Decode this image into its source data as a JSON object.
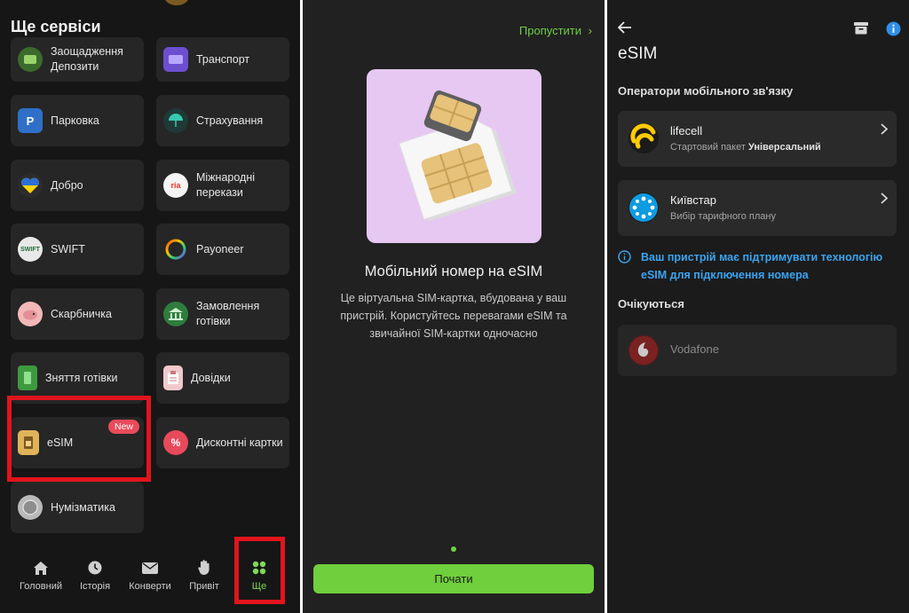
{
  "panel1": {
    "title": "Ще сервіси",
    "tiles": [
      {
        "label": "Заощадження\nДепозити",
        "icon": "piggy-bank-deposit-icon"
      },
      {
        "label": "Транспорт",
        "icon": "transport-ticket-icon"
      },
      {
        "label": "Парковка",
        "icon": "parking-icon"
      },
      {
        "label": "Страхування",
        "icon": "umbrella-icon"
      },
      {
        "label": "Добро",
        "icon": "ukraine-heart-icon"
      },
      {
        "label": "Міжнародні\nперекази",
        "icon": "ria-money-transfer-icon"
      },
      {
        "label": "SWIFT",
        "icon": "swift-icon"
      },
      {
        "label": "Payoneer",
        "icon": "payoneer-icon"
      },
      {
        "label": "Скарбничка",
        "icon": "piggy-icon"
      },
      {
        "label": "Замовлення\nготівки",
        "icon": "bank-building-icon"
      },
      {
        "label": "Зняття готівки",
        "icon": "atm-icon"
      },
      {
        "label": "Довідки",
        "icon": "clipboard-icon"
      },
      {
        "label": "eSIM",
        "icon": "sim-card-icon",
        "badge": "New"
      },
      {
        "label": "Дисконтні картки",
        "icon": "discount-percent-icon"
      },
      {
        "label": "Нумізматика",
        "icon": "coin-icon"
      }
    ],
    "ria_text": "ria",
    "swift_icon_text": "SWIFT",
    "nav": [
      {
        "label": "Головний",
        "icon": "home-icon"
      },
      {
        "label": "Історія",
        "icon": "clock-icon"
      },
      {
        "label": "Конверти",
        "icon": "envelope-icon"
      },
      {
        "label": "Привіт",
        "icon": "hand-wave-icon"
      },
      {
        "label": "Ще",
        "icon": "grid-dots-icon",
        "active": true
      }
    ]
  },
  "panel2": {
    "skip_label": "Пропустити",
    "title": "Мобільний номер на eSIM",
    "description": "Це віртуальна SIM-картка, вбудована у ваш пристрій. Користуйтесь перевагами eSIM та звичайної SIM-картки одночасно",
    "start_label": "Почати"
  },
  "panel3": {
    "title": "eSIM",
    "operators_heading": "Оператори мобільного зв'язку",
    "operators": [
      {
        "name": "lifecell",
        "sub_prefix": "Стартовий пакет ",
        "sub_bold": "Універсальний"
      },
      {
        "name": "Київстар",
        "sub_prefix": "Вибір тарифного плану",
        "sub_bold": ""
      }
    ],
    "note": "Ваш пристрій має підтримувати технологію eSIM для підключення номера",
    "expected_heading": "Очікуються",
    "expected": [
      {
        "name": "Vodafone"
      }
    ]
  },
  "colors": {
    "accent_green": "#6fcf3c",
    "highlight_red": "#e2141c",
    "info_blue": "#3ba4f0",
    "badge_red": "#e94b5b"
  }
}
